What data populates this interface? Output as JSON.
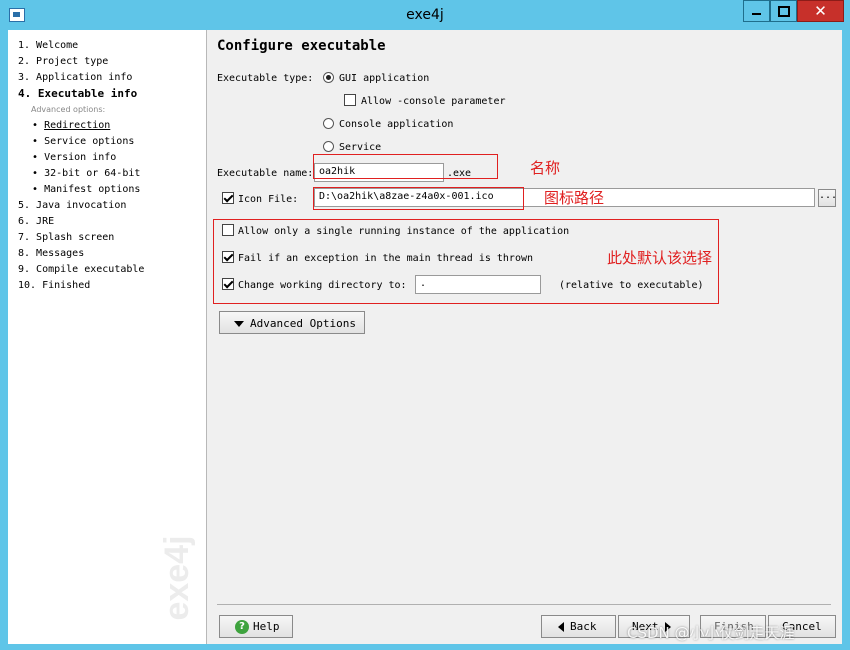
{
  "window": {
    "title": "exe4j",
    "close_glyph": "✕"
  },
  "sidebar": {
    "items": [
      {
        "label": "1.  Welcome"
      },
      {
        "label": "2.  Project type"
      },
      {
        "label": "3.  Application info"
      },
      {
        "label": "4.  Executable info"
      },
      {
        "label": "5.  Java invocation"
      },
      {
        "label": "6.  JRE"
      },
      {
        "label": "7.  Splash screen"
      },
      {
        "label": "8.  Messages"
      },
      {
        "label": "9.  Compile executable"
      },
      {
        "label": "10.  Finished"
      }
    ],
    "advanced_caption": "Advanced options:",
    "subitems": [
      {
        "label": "Redirection"
      },
      {
        "label": "Service options"
      },
      {
        "label": "Version info"
      },
      {
        "label": "32-bit or 64-bit"
      },
      {
        "label": "Manifest options"
      }
    ],
    "bullet": "•",
    "watermark": "exe4j"
  },
  "main": {
    "title": "Configure executable",
    "exe_type_label": "Executable type:",
    "options": {
      "gui": "GUI application",
      "allow_console": "Allow -console parameter",
      "console": "Console application",
      "service": "Service"
    },
    "exe_name_label": "Executable name:",
    "exe_name_value": "oa2hik",
    "exe_suffix": ".exe",
    "icon_file_label": "Icon File:",
    "icon_file_value": "D:\\oa2hik\\a8zae-z4a0x-001.ico",
    "browse_label": "...",
    "single_instance": "Allow only a single running instance of the application",
    "fail_exception": "Fail if an exception in the main thread is thrown",
    "change_dir": "Change working directory to:",
    "working_dir_value": ".",
    "relative_note": "(relative to executable)",
    "advanced_button": "Advanced Options"
  },
  "annotations": {
    "name_note": "名称",
    "icon_note": "图标路径",
    "default_note": "此处默认该选择",
    "color": "#e02020"
  },
  "footer": {
    "help": "Help",
    "back": "Back",
    "next": "Next",
    "finish": "Finish",
    "cancel": "Cancel",
    "credit": "CSDN @小小仗剑走天涯"
  }
}
